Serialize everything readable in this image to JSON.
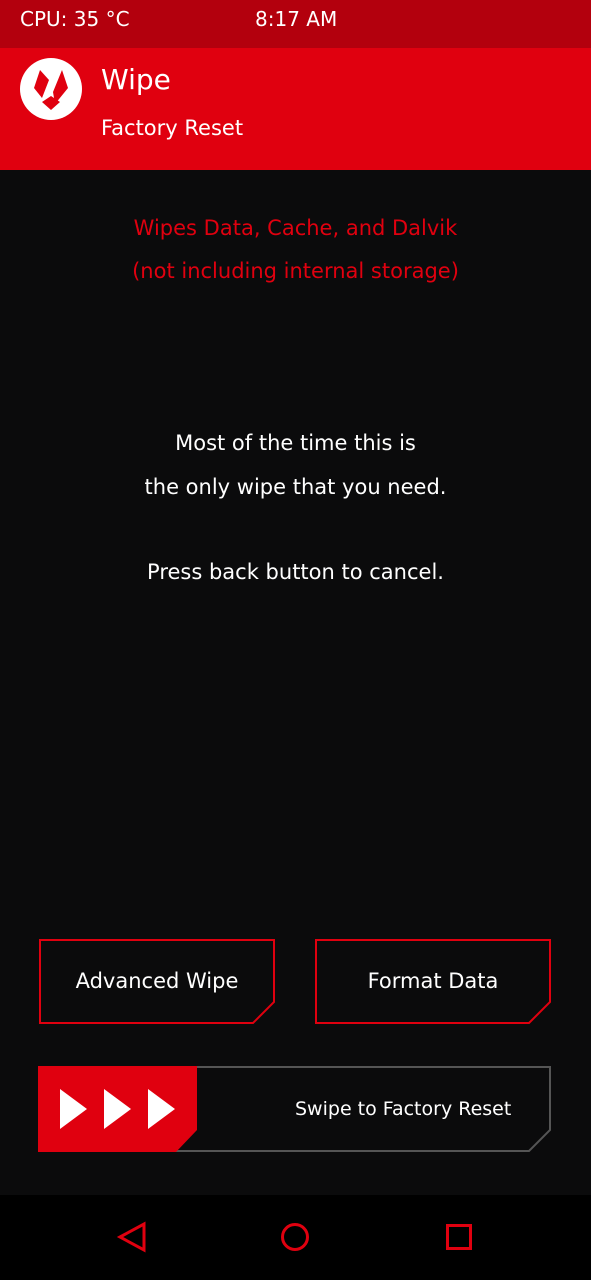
{
  "status_bar": {
    "cpu": "CPU: 35 °C",
    "time": "8:17 AM"
  },
  "header": {
    "title": "Wipe",
    "subtitle": "Factory Reset",
    "logo_icon": "twrp-logo-icon"
  },
  "warning": {
    "line1": "Wipes Data, Cache, and Dalvik",
    "line2": "(not including internal storage)"
  },
  "info": {
    "line1": "Most of the time this is",
    "line2": "the only wipe that you need.",
    "line3": "Press back button to cancel."
  },
  "buttons": {
    "advanced_wipe": "Advanced Wipe",
    "format_data": "Format Data"
  },
  "slider": {
    "label": "Swipe to Factory Reset",
    "handle_icon": "triple-arrow-right-icon"
  },
  "navbar": {
    "back_icon": "back-triangle-icon",
    "home_icon": "home-circle-icon",
    "recents_icon": "recents-square-icon"
  },
  "colors": {
    "accent": "#e0000f",
    "status_bar": "#b3000d",
    "background": "#0b0b0c",
    "text": "#ffffff"
  }
}
